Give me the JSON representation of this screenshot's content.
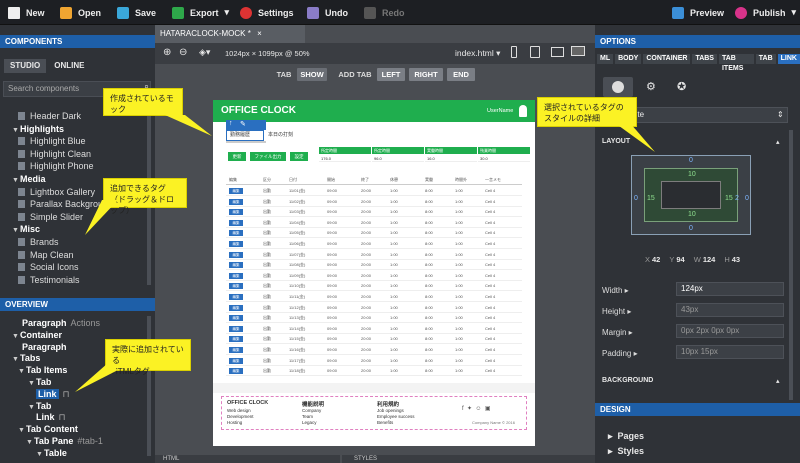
{
  "toolbar": {
    "new": "New",
    "open": "Open",
    "save": "Save",
    "export": "Export",
    "settings": "Settings",
    "undo": "Undo",
    "redo": "Redo",
    "preview": "Preview",
    "publish": "Publish"
  },
  "components": {
    "header": "COMPONENTS",
    "tab_studio": "STUDIO",
    "tab_online": "ONLINE",
    "search_placeholder": "Search components",
    "items": [
      {
        "label": "Header Dark",
        "type": "item"
      },
      {
        "label": "Highlights",
        "type": "group"
      },
      {
        "label": "Highlight Blue",
        "type": "item"
      },
      {
        "label": "Highlight Clean",
        "type": "item"
      },
      {
        "label": "Highlight Phone",
        "type": "item"
      },
      {
        "label": "Media",
        "type": "group"
      },
      {
        "label": "Lightbox Gallery",
        "type": "item"
      },
      {
        "label": "Parallax Background",
        "type": "item"
      },
      {
        "label": "Simple Slider",
        "type": "item"
      },
      {
        "label": "Misc",
        "type": "group"
      },
      {
        "label": "Brands",
        "type": "item"
      },
      {
        "label": "Map Clean",
        "type": "item"
      },
      {
        "label": "Social Icons",
        "type": "item"
      },
      {
        "label": "Testimonials",
        "type": "item"
      }
    ]
  },
  "overview": {
    "header": "OVERVIEW",
    "items": [
      {
        "label": "Paragraph",
        "extra": "Actions"
      },
      {
        "label": "Container",
        "extra": ""
      },
      {
        "label": "Paragraph",
        "extra": ""
      },
      {
        "label": "Tabs",
        "extra": ""
      },
      {
        "label": "Tab Items",
        "extra": ""
      },
      {
        "label": "Tab",
        "extra": ""
      },
      {
        "label": "Link",
        "extra": ""
      },
      {
        "label": "Tab",
        "extra": ""
      },
      {
        "label": "Link",
        "extra": ""
      },
      {
        "label": "Tab Content",
        "extra": ""
      },
      {
        "label": "Tab Pane",
        "extra": "#tab-1"
      },
      {
        "label": "Table",
        "extra": ""
      }
    ]
  },
  "document": {
    "tab_name": "HATARACLOCK-MOCK *",
    "size": "1024px × 1099px @ 50%",
    "file": "index.html",
    "tab_buttons": [
      "TAB",
      "SHOW",
      "ADD TAB",
      "LEFT",
      "RIGHT",
      "END"
    ],
    "bottom_left": "HTML",
    "bottom_right": "STYLES"
  },
  "mock": {
    "title": "OFFICE CLOCK",
    "username": "UserName",
    "tab1": "勤務履歴",
    "tab2": "本日の打刻",
    "buttons": [
      "更新",
      "ファイル出力",
      "設定"
    ],
    "summary_headers": [
      "所定時間",
      "所定時間",
      "実働時間",
      "残業時間"
    ],
    "summary_values": [
      "176.0",
      "96.0",
      "16.0",
      "30.0"
    ],
    "table_headers": [
      "編集",
      "区分",
      "日付",
      "開始",
      "終了",
      "休憩",
      "実働",
      "時間外",
      "一言メモ"
    ],
    "rows": [
      [
        "編集",
        "出勤",
        "11/01(金)",
        "09:00",
        "20:00",
        "1:00",
        "8:00",
        "1:00",
        "Cell 4"
      ],
      [
        "編集",
        "出勤",
        "11/02(金)",
        "09:00",
        "20:00",
        "1:00",
        "8:00",
        "1:00",
        "Cell 4"
      ],
      [
        "編集",
        "出勤",
        "11/03(金)",
        "09:00",
        "20:00",
        "1:00",
        "8:00",
        "1:00",
        "Cell 4"
      ],
      [
        "編集",
        "出勤",
        "11/04(金)",
        "09:00",
        "20:00",
        "1:00",
        "8:00",
        "1:00",
        "Cell 4"
      ],
      [
        "編集",
        "出勤",
        "11/05(金)",
        "09:00",
        "20:00",
        "1:00",
        "8:00",
        "1:00",
        "Cell 4"
      ],
      [
        "編集",
        "出勤",
        "11/06(金)",
        "09:00",
        "20:00",
        "1:00",
        "8:00",
        "1:00",
        "Cell 4"
      ],
      [
        "編集",
        "出勤",
        "11/07(金)",
        "09:00",
        "20:00",
        "1:00",
        "8:00",
        "1:00",
        "Cell 4"
      ],
      [
        "編集",
        "出勤",
        "11/08(金)",
        "09:00",
        "20:00",
        "1:00",
        "8:00",
        "1:00",
        "Cell 4"
      ],
      [
        "編集",
        "出勤",
        "11/09(金)",
        "09:00",
        "20:00",
        "1:00",
        "8:00",
        "1:00",
        "Cell 4"
      ],
      [
        "編集",
        "出勤",
        "11/10(金)",
        "09:00",
        "20:00",
        "1:00",
        "8:00",
        "1:00",
        "Cell 4"
      ],
      [
        "編集",
        "出勤",
        "11/11(金)",
        "09:00",
        "20:00",
        "1:00",
        "8:00",
        "1:00",
        "Cell 4"
      ],
      [
        "編集",
        "出勤",
        "11/12(金)",
        "09:00",
        "20:00",
        "1:00",
        "8:00",
        "1:00",
        "Cell 4"
      ],
      [
        "編集",
        "出勤",
        "11/13(金)",
        "09:00",
        "20:00",
        "1:00",
        "8:00",
        "1:00",
        "Cell 4"
      ],
      [
        "編集",
        "出勤",
        "11/14(金)",
        "09:00",
        "20:00",
        "1:00",
        "8:00",
        "1:00",
        "Cell 4"
      ],
      [
        "編集",
        "出勤",
        "11/15(金)",
        "09:00",
        "20:00",
        "1:00",
        "8:00",
        "1:00",
        "Cell 4"
      ],
      [
        "編集",
        "出勤",
        "11/16(金)",
        "09:00",
        "20:00",
        "1:00",
        "8:00",
        "1:00",
        "Cell 4"
      ],
      [
        "編集",
        "出勤",
        "11/17(金)",
        "09:00",
        "20:00",
        "1:00",
        "8:00",
        "1:00",
        "Cell 4"
      ],
      [
        "編集",
        "出勤",
        "11/18(金)",
        "09:00",
        "20:00",
        "1:00",
        "8:00",
        "1:00",
        "Cell 4"
      ]
    ],
    "footer": {
      "col1_title": "OFFICE CLOCK",
      "col1": [
        "Web design",
        "Development",
        "Hosting"
      ],
      "col2_title": "機能説明",
      "col2": [
        "Company",
        "Team",
        "Legacy"
      ],
      "col3_title": "利用規約",
      "col3": [
        "Job openings",
        "Employee success",
        "Benefits"
      ],
      "copyright": "Company Name © 2016"
    }
  },
  "options": {
    "header": "OPTIONS",
    "tabs": [
      "ML",
      "BODY",
      "CONTAINER",
      "TABS",
      "TAB ITEMS",
      "TAB",
      "LINK"
    ],
    "attribute": "ribute",
    "layout_label": "LAYOUT",
    "box": {
      "outer_top": "0",
      "outer_left": "0",
      "outer_right": "0",
      "outer_bottom": "0",
      "inner_top": "10",
      "inner_left": "15",
      "inner_right": "15",
      "inner_bottom": "10",
      "center_right": "2"
    },
    "coords": [
      {
        "k": "X",
        "v": "42"
      },
      {
        "k": "Y",
        "v": "94"
      },
      {
        "k": "W",
        "v": "124"
      },
      {
        "k": "H",
        "v": "43"
      }
    ],
    "width_label": "Width",
    "width_value": "124px",
    "height_label": "Height",
    "height_value": "43px",
    "margin_label": "Margin",
    "margin_value": "0px 2px 0px 0px",
    "padding_label": "Padding",
    "padding_value": "10px 15px",
    "background_label": "BACKGROUND"
  },
  "design": {
    "header": "DESIGN",
    "items": [
      "Pages",
      "Styles"
    ]
  },
  "callouts": {
    "mock": "作成されているモック",
    "tags": "追加できるタグ\n（ドラッグ＆ドロップ）",
    "html": "実際に追加されている\nHTMLタグ",
    "style": "選択されているタグの\nスタイルの詳細"
  },
  "colors": {
    "accent": "#1e5fa8",
    "brand_green": "#1fae4e",
    "callout": "#fbf224"
  }
}
